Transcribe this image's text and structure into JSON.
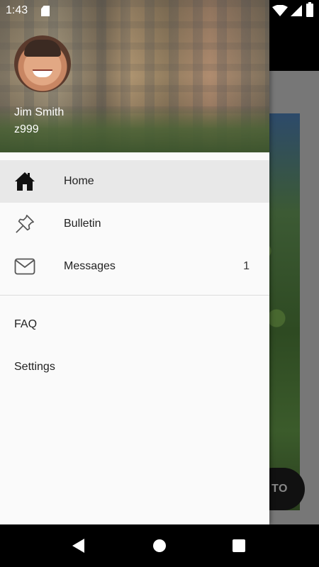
{
  "status_bar": {
    "time": "1:43"
  },
  "drawer": {
    "user_name": "Jim Smith",
    "user_id": "z999",
    "nav_items": [
      {
        "label": "Home",
        "icon": "home-icon",
        "count": ""
      },
      {
        "label": "Bulletin",
        "icon": "pin-icon",
        "count": ""
      },
      {
        "label": "Messages",
        "icon": "mail-icon",
        "count": "1"
      }
    ],
    "secondary_items": [
      {
        "label": "FAQ"
      },
      {
        "label": "Settings"
      }
    ]
  },
  "background": {
    "fab_label": "TO"
  },
  "colors": {
    "drawer_bg": "#fafafa",
    "active_item_bg": "#e8e8e8",
    "nav_bar_bg": "#000000"
  }
}
